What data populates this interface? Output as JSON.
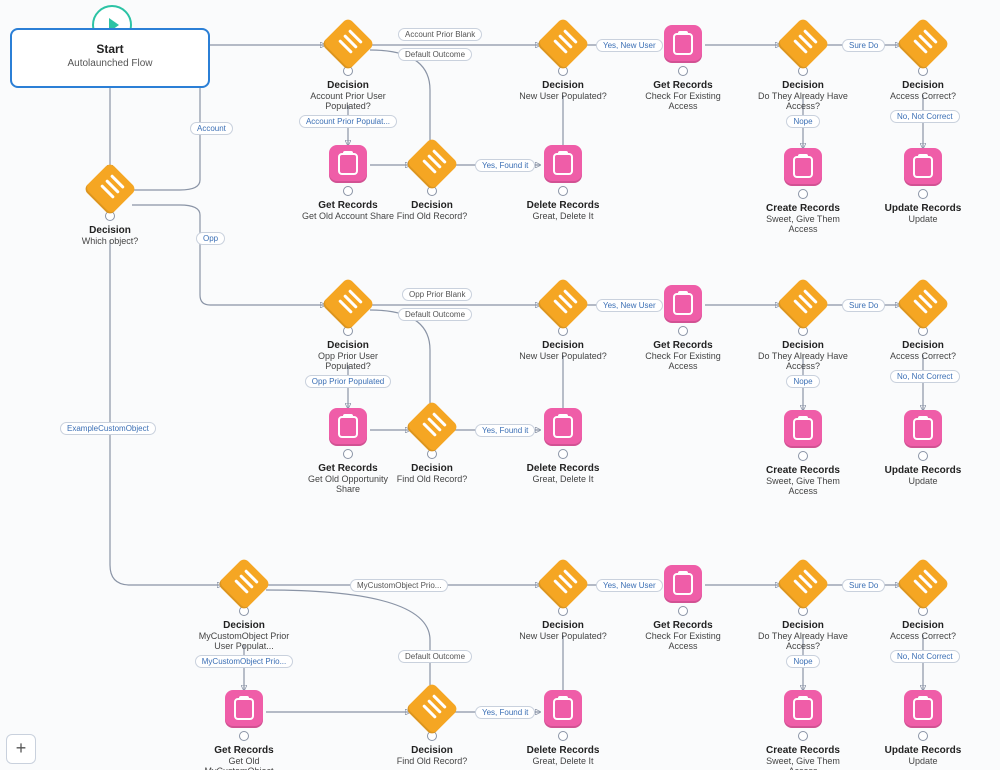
{
  "start": {
    "title": "Start",
    "subtitle": "Autolaunched Flow"
  },
  "root_decision": {
    "title": "Decision",
    "sub": "Which object?"
  },
  "root_outcomes": {
    "account": "Account",
    "opp": "Opp",
    "custom": "ExampleCustomObject"
  },
  "lane": {
    "prior_user_title": "Decision",
    "new_user_title": "Decision",
    "new_user_sub": "New User Populated?",
    "get_old_title": "Get Records",
    "find_old_title": "Decision",
    "find_old_sub": "Find Old Record?",
    "delete_title": "Delete Records",
    "delete_sub": "Great, Delete It",
    "check_access_title": "Get Records",
    "check_access_sub": "Check For Existing Access",
    "have_access_title": "Decision",
    "have_access_sub": "Do They Already Have Access?",
    "create_title": "Create Records",
    "create_sub": "Sweet, Give Them Access",
    "access_correct_title": "Decision",
    "access_correct_sub": "Access Correct?",
    "update_title": "Update Records",
    "update_sub": "Update"
  },
  "lanes": {
    "account": {
      "prior_user_sub": "Account Prior User Populated?",
      "prior_user_chip": "Account Prior Populat...",
      "prior_blank": "Account Prior Blank",
      "get_old_sub": "Get Old Account Share"
    },
    "opp": {
      "prior_user_sub": "Opp Prior User Populated?",
      "prior_user_chip": "Opp Prior Populated",
      "prior_blank": "Opp Prior Blank",
      "get_old_sub": "Get Old Opportunity Share"
    },
    "custom": {
      "prior_user_sub": "MyCustomObject Prior User Populat...",
      "prior_user_chip": "MyCustomObject Prio...",
      "prior_blank": "MyCustomObject Prio...",
      "get_old_sub": "Get Old MyCustomObject ..."
    }
  },
  "edge_labels": {
    "default_outcome": "Default Outcome",
    "yes_found_it": "Yes, Found it",
    "yes_new_user": "Yes, New User",
    "nope": "Nope",
    "sure_do": "Sure Do",
    "no_not_correct": "No, Not Correct"
  },
  "plus": "+"
}
